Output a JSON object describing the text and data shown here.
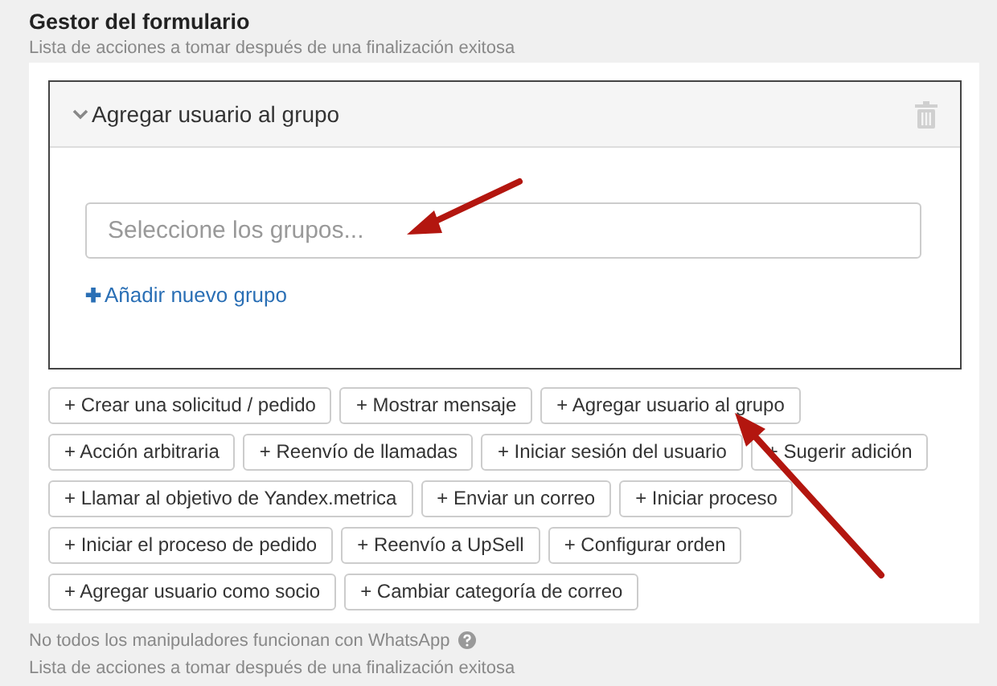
{
  "title": "Gestor del formulario",
  "subtitle": "Lista de acciones a tomar después de una finalización exitosa",
  "action_card": {
    "title": "Agregar usuario al grupo",
    "expanded": true,
    "group_field": {
      "placeholder": "Seleccione los grupos..."
    },
    "add_group_link": {
      "icon": "✚",
      "label": "Añadir nuevo grupo"
    }
  },
  "action_buttons": [
    [
      "+ Crear una solicitud / pedido",
      "+ Mostrar mensaje",
      "+ Agregar usuario al grupo"
    ],
    [
      "+ Acción arbitraria",
      "+ Reenvío de llamadas",
      "+ Iniciar sesión del usuario",
      "+ Sugerir adición"
    ],
    [
      "+ Llamar al objetivo de Yandex.metrica",
      "+ Enviar un correo",
      "+ Iniciar proceso"
    ],
    [
      "+ Iniciar el proceso de pedido",
      "+ Reenvío a UpSell",
      "+ Configurar orden"
    ],
    [
      "+ Agregar usuario como socio",
      "+ Cambiar categoría de correo"
    ]
  ],
  "note": "No todos los manipuladores funcionan con WhatsApp",
  "footer": "Lista de acciones a tomar después de una finalización exitosa"
}
